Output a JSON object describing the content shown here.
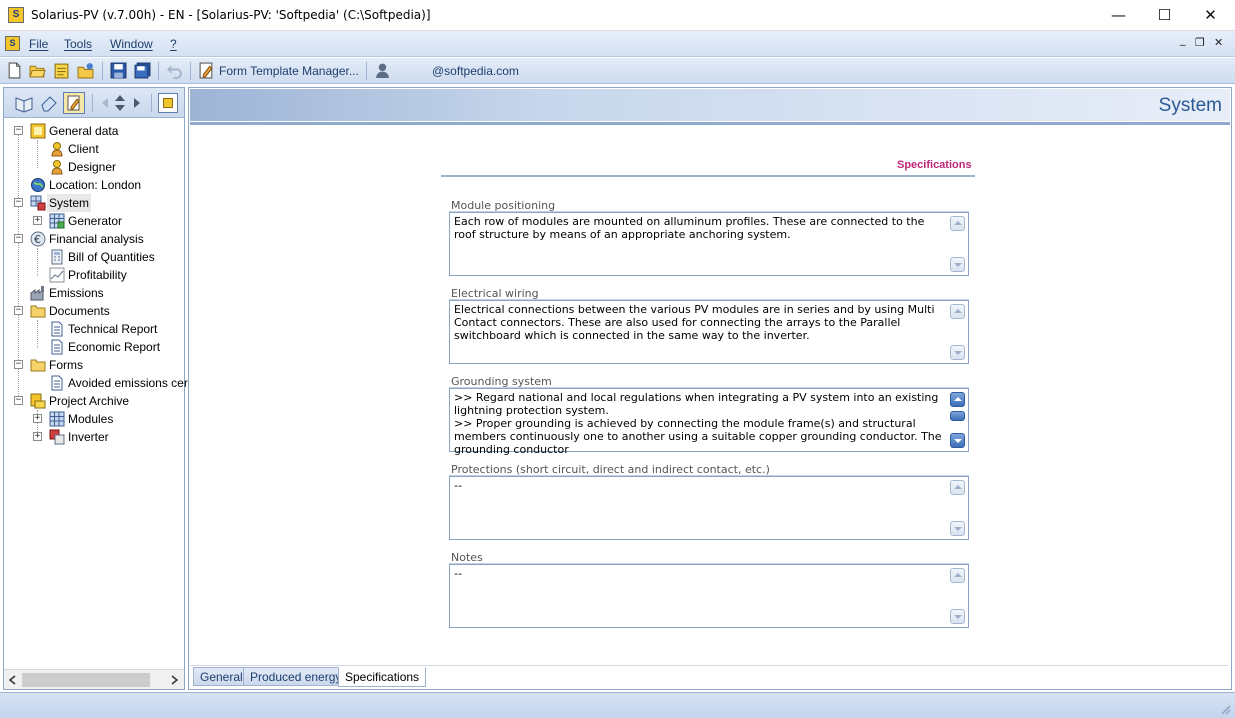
{
  "window": {
    "title": "Solarius-PV (v.7.00h) - EN - [Solarius-PV: 'Softpedia' (C:\\Softpedia)]",
    "minimize_glyph": "—",
    "maximize_glyph": "☐",
    "close_glyph": "✕"
  },
  "menu": {
    "items": [
      "File",
      "Tools",
      "Window",
      "?"
    ],
    "mdi_min": "_",
    "mdi_restore": "❐",
    "mdi_close": "✕"
  },
  "toolbar": {
    "form_template_manager": "Form Template Manager...",
    "user_email": "@softpedia.com"
  },
  "tree": {
    "items": [
      {
        "label": "General data",
        "icon": "folder-general-icon"
      },
      {
        "label": "Client",
        "icon": "person-icon"
      },
      {
        "label": "Designer",
        "icon": "person-icon"
      },
      {
        "label": "Location: London",
        "icon": "globe-icon"
      },
      {
        "label": "System",
        "icon": "system-icon"
      },
      {
        "label": "Generator",
        "icon": "grid-icon"
      },
      {
        "label": "Financial analysis",
        "icon": "euro-icon"
      },
      {
        "label": "Bill of Quantities",
        "icon": "calculator-icon"
      },
      {
        "label": "Profitability",
        "icon": "chart-icon"
      },
      {
        "label": "Emissions",
        "icon": "factory-icon"
      },
      {
        "label": "Documents",
        "icon": "folder-icon"
      },
      {
        "label": "Technical Report",
        "icon": "document-icon"
      },
      {
        "label": "Economic Report",
        "icon": "document-icon"
      },
      {
        "label": "Forms",
        "icon": "folder-icon"
      },
      {
        "label": "Avoided emissions certif",
        "icon": "document-icon"
      },
      {
        "label": "Project Archive",
        "icon": "archive-icon"
      },
      {
        "label": "Modules",
        "icon": "grid-icon"
      },
      {
        "label": "Inverter",
        "icon": "inverter-icon"
      }
    ]
  },
  "main": {
    "header_title": "System",
    "section_title": "Specifications",
    "fields": [
      {
        "label": "Module positioning",
        "value": "Each row of modules are mounted on alluminum profiles. These are connected to the roof structure by means of an appropriate anchoring system."
      },
      {
        "label": "Electrical wiring",
        "value": "Electrical connections between the various PV modules are in series and by using Multi Contact connectors. These are also used for connecting the arrays to the Parallel switchboard which is connected in the same way to the inverter."
      },
      {
        "label": "Grounding system",
        "value": ">> Regard national and local regulations when integrating a PV system into an existing lightning protection system.\n>> Proper grounding is achieved by connecting the module frame(s) and structural members continuously one to another using a suitable copper grounding conductor. The grounding conductor"
      },
      {
        "label": "Protections (short circuit, direct and indirect contact, etc.)",
        "value": "--"
      },
      {
        "label": "Notes",
        "value": "--"
      }
    ],
    "tabs": [
      "General",
      "Produced energy",
      "Specifications"
    ],
    "active_tab": "Specifications"
  },
  "colors": {
    "accent_title": "#c0267a",
    "header_text": "#2a5a93",
    "menu_text": "#1e3e6e"
  }
}
